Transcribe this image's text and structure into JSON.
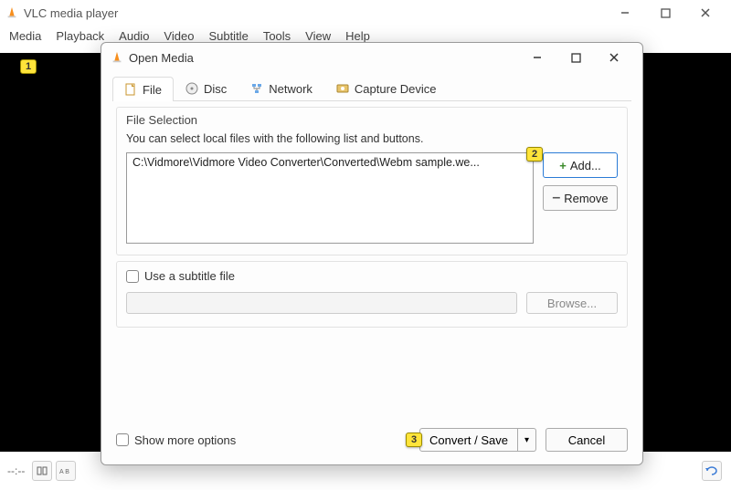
{
  "main_window": {
    "title": "VLC media player",
    "menubar": [
      "Media",
      "Playback",
      "Audio",
      "Video",
      "Subtitle",
      "Tools",
      "View",
      "Help"
    ],
    "time_left": "--:--",
    "time_right": "--:--"
  },
  "dialog": {
    "title": "Open Media",
    "tabs": [
      {
        "label": "File",
        "icon": "file-icon"
      },
      {
        "label": "Disc",
        "icon": "disc-icon"
      },
      {
        "label": "Network",
        "icon": "network-icon"
      },
      {
        "label": "Capture Device",
        "icon": "capture-icon"
      }
    ],
    "file_section": {
      "legend": "File Selection",
      "hint": "You can select local files with the following list and buttons.",
      "files": [
        "C:\\Vidmore\\Vidmore Video Converter\\Converted\\Webm sample.we..."
      ],
      "add_label": "Add...",
      "remove_label": "Remove"
    },
    "subtitle_section": {
      "checkbox_label": "Use a subtitle file",
      "browse_label": "Browse..."
    },
    "show_more_label": "Show more options",
    "convert_label": "Convert / Save",
    "cancel_label": "Cancel"
  },
  "badges": [
    "1",
    "2",
    "3"
  ]
}
